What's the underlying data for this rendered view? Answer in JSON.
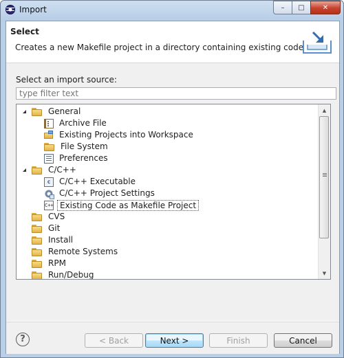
{
  "window": {
    "title": "Import",
    "min_glyph": "–",
    "max_glyph": "□",
    "close_glyph": "✕"
  },
  "header": {
    "title": "Select",
    "description": "Creates a new Makefile project in a directory containing existing code",
    "icon": "import-wizard-icon"
  },
  "source": {
    "label": "Select an import source:",
    "filter_placeholder": "type filter text",
    "filter_value": ""
  },
  "tree": {
    "items": [
      {
        "label": "General",
        "level": 0,
        "expanded": true,
        "icon": "folder-icon"
      },
      {
        "label": "Archive File",
        "level": 1,
        "icon": "archive-file-icon"
      },
      {
        "label": "Existing Projects into Workspace",
        "level": 1,
        "icon": "existing-projects-icon"
      },
      {
        "label": "File System",
        "level": 1,
        "icon": "folder-icon"
      },
      {
        "label": "Preferences",
        "level": 1,
        "icon": "preferences-icon"
      },
      {
        "label": "C/C++",
        "level": 0,
        "expanded": true,
        "icon": "folder-icon"
      },
      {
        "label": "C/C++ Executable",
        "level": 1,
        "icon": "executable-icon"
      },
      {
        "label": "C/C++ Project Settings",
        "level": 1,
        "icon": "project-settings-icon"
      },
      {
        "label": "Existing Code as Makefile Project",
        "level": 1,
        "icon": "cpp-project-icon",
        "selected": true
      },
      {
        "label": "CVS",
        "level": 0,
        "expanded": false,
        "icon": "folder-icon"
      },
      {
        "label": "Git",
        "level": 0,
        "expanded": false,
        "icon": "folder-icon"
      },
      {
        "label": "Install",
        "level": 0,
        "expanded": false,
        "icon": "folder-icon"
      },
      {
        "label": "Remote Systems",
        "level": 0,
        "expanded": false,
        "icon": "folder-icon"
      },
      {
        "label": "RPM",
        "level": 0,
        "expanded": false,
        "icon": "folder-icon"
      },
      {
        "label": "Run/Debug",
        "level": 0,
        "expanded": false,
        "icon": "folder-icon"
      }
    ],
    "exe_glyph": "c",
    "cpp_glyph": "C++"
  },
  "footer": {
    "help_glyph": "?",
    "back_label": "< Back",
    "next_label": "Next >",
    "finish_label": "Finish",
    "cancel_label": "Cancel"
  }
}
